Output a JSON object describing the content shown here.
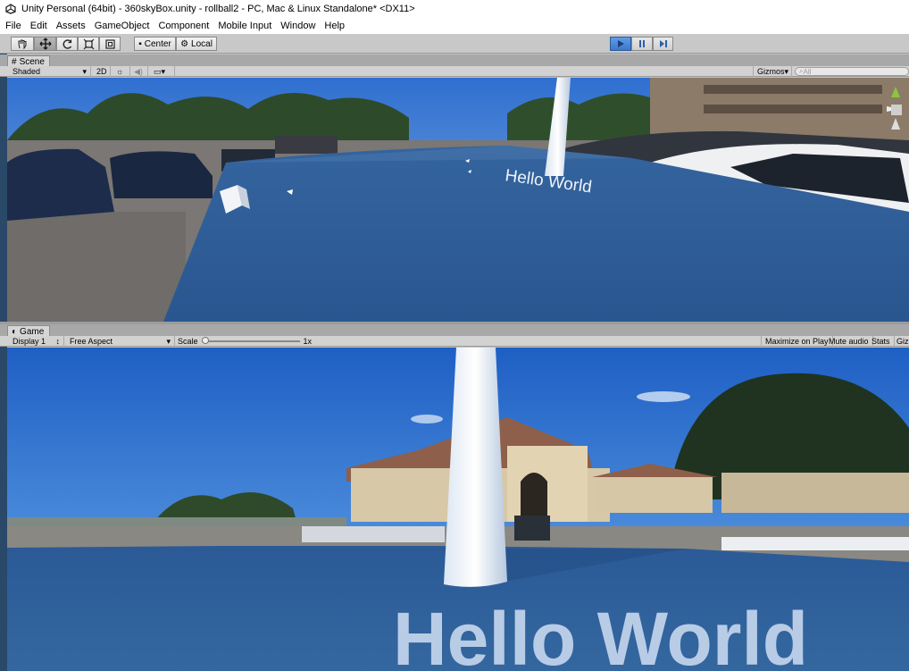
{
  "window": {
    "title": "Unity Personal (64bit) - 360skyBox.unity - rollball2 - PC, Mac & Linux Standalone* <DX11>"
  },
  "menu": [
    "File",
    "Edit",
    "Assets",
    "GameObject",
    "Component",
    "Mobile Input",
    "Window",
    "Help"
  ],
  "toolbar": {
    "pivot_center": "Center",
    "pivot_local": "Local"
  },
  "scene": {
    "tab": "Scene",
    "shading": "Shaded",
    "mode_2d": "2D",
    "gizmos": "Gizmos",
    "search_placeholder": "All",
    "world_text": "Hello World"
  },
  "game": {
    "tab": "Game",
    "display": "Display 1",
    "aspect": "Free Aspect",
    "scale_label": "Scale",
    "scale_value": "1x",
    "maximize": "Maximize on Play",
    "mute": "Mute audio",
    "stats": "Stats",
    "gizmos": "Gizm",
    "world_text": "Hello World"
  },
  "colors": {
    "play_accent": "#3d78c9",
    "floor_blue": "#2f5f9e",
    "sky": "#4a8ad9"
  }
}
